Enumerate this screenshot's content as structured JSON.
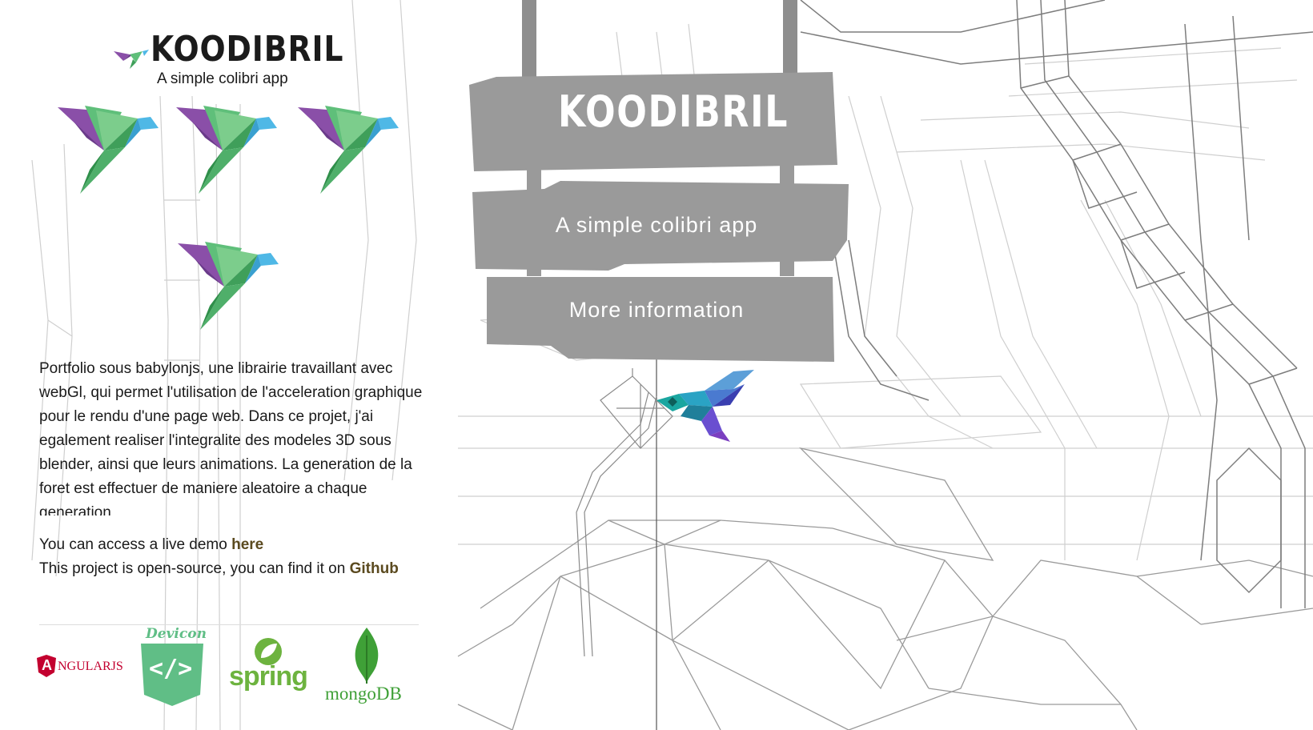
{
  "brand": {
    "title": "KOODIBRIL",
    "subtitle": "A simple colibri app"
  },
  "gallery": {
    "images": [
      "hummingbird-icon",
      "hummingbird-icon",
      "hummingbird-icon",
      "hummingbird-icon"
    ]
  },
  "description": {
    "text": "Portfolio sous babylonjs, une librairie travaillant avec webGl, qui permet l'utilisation de l'acceleration graphique pour le rendu d'une page web. Dans ce projet, j'ai egalement realiser l'integralite des modeles 3D sous blender, ainsi que leurs animations. La generation de la foret est effectuer de maniere aleatoire a chaque generation"
  },
  "links": {
    "demo_prefix": "You can access a live demo ",
    "demo_link": "here",
    "source_prefix": "This project is open-source, you can find it on ",
    "source_link": "Github"
  },
  "tech": {
    "angular_letter": "A",
    "angular_text": "NGULARJS",
    "devicon_label": "Devicon",
    "devicon_symbol": "</>",
    "spring_label": "spring",
    "mongodb_label": "mongoDB"
  },
  "sign": {
    "title": "KOODIBRIL",
    "subtitle": "A simple colibri app",
    "more_info": "More information"
  },
  "colors": {
    "plank": "#9a9a9a",
    "plank_dark": "#8a8a8a",
    "link": "#5b4a1f",
    "bird_purple": "#8a4fa8",
    "bird_green": "#5fbf7a",
    "bird_blue": "#4fb8e6",
    "angular_red": "#c3002f",
    "devicon_green": "#60be86",
    "spring_green": "#6db33f",
    "mongo_green": "#3fa037"
  }
}
